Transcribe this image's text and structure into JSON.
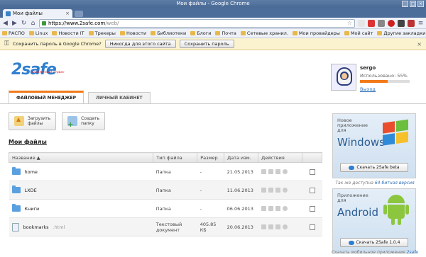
{
  "window": {
    "title": "Мои файлы - Google Chrome"
  },
  "tab": {
    "title": "Мои файлы",
    "close": "×"
  },
  "address": {
    "host": "https://www.2safe.com",
    "path": "/web/"
  },
  "bookmarks": {
    "items": [
      "РАСПО",
      "Linux",
      "Новости IT",
      "Трекеры",
      "Новости",
      "Библиотеки",
      "Блоги",
      "Почта",
      "Сетевые хранил.",
      "Мои провайдеры",
      "Мой сайт"
    ],
    "other": "Другие закладки"
  },
  "infobar": {
    "message": "Сохранить пароль в Google Chrome?",
    "never_label": "Никогда для этого сайта",
    "save_label": "Сохранить пароль"
  },
  "logo": {
    "brand": "2safe",
    "tagline": "заоблачный сервис"
  },
  "user": {
    "name": "sergo",
    "usage": "Использовано: 55%",
    "usage_fraction": 0.55,
    "logout": "Выход"
  },
  "tabs": {
    "files": "ФАЙЛОВЫЙ МЕНЕДЖЕР",
    "cabinet": "ЛИЧНЫЙ КАБИНЕТ"
  },
  "actions": {
    "upload_l1": "Загрузить",
    "upload_l2": "файлы",
    "create_l1": "Создать",
    "create_l2": "папку"
  },
  "section_title": "Мои файлы",
  "table": {
    "headers": {
      "name": "Название ▲",
      "type": "Тип файла",
      "size": "Размер",
      "date": "Дата изм.",
      "actions": "Действия"
    },
    "rows": [
      {
        "name": "home",
        "ext": "",
        "type": "Папка",
        "size": "-",
        "date": "21.05.2013",
        "icon": "folder"
      },
      {
        "name": "LXDE",
        "ext": "",
        "type": "Папка",
        "size": "-",
        "date": "11.06.2013",
        "icon": "folder"
      },
      {
        "name": "Книги",
        "ext": "",
        "type": "Папка",
        "size": "-",
        "date": "06.06.2013",
        "icon": "folder"
      },
      {
        "name": "bookmarks",
        "ext": ".html",
        "type": "Текстовый документ",
        "size": "405.85 КБ",
        "date": "20.06.2013",
        "icon": "document"
      }
    ]
  },
  "promo_windows": {
    "l1": "Новое",
    "l2": "приложение",
    "l3": "для",
    "os": "Windows",
    "button": "Скачать 2Safe beta",
    "note_prefix": "Так же доступна ",
    "note_link": "64-битная версия"
  },
  "promo_android": {
    "l1": "Приложение",
    "l2": "для",
    "os": "Android",
    "button": "Скачать 2Safe 1.0.4",
    "note_prefix": "Скачать мобильное приложение ",
    "note_link": "2safe"
  },
  "colors": {
    "accent": "#f27a1a",
    "link": "#2f6fb8",
    "brand": "#2f7fd0"
  }
}
